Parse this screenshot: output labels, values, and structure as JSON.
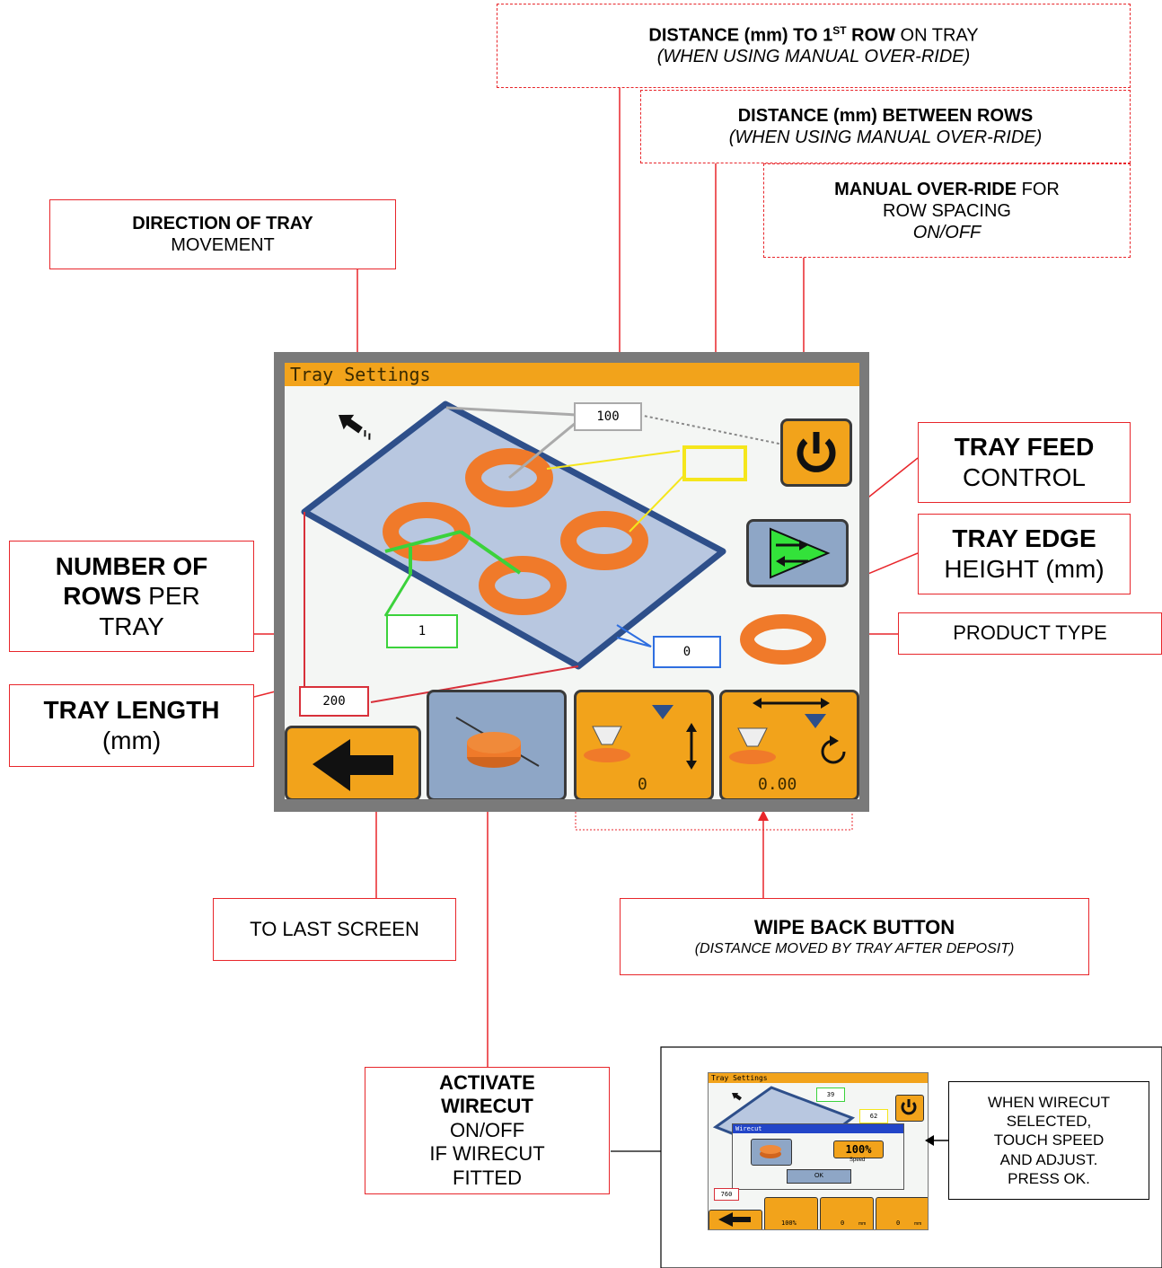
{
  "screen": {
    "title": "Tray Settings",
    "first_row_distance": "100",
    "row_spacing": "",
    "rows_per_tray": "1",
    "tray_edge_height": "0",
    "tray_length": "200",
    "wipe_up_value": "0",
    "wipe_back_value": "0.00"
  },
  "callouts": {
    "first_row": {
      "bold": "DISTANCE (mm) TO 1",
      "sup": "ST",
      "bold2": " ROW",
      "normal": " ON TRAY",
      "italic": "(WHEN USING MANUAL OVER-RIDE)"
    },
    "between_rows": {
      "bold": "DISTANCE (mm) BETWEEN ROWS",
      "italic": "(WHEN USING MANUAL OVER-RIDE)"
    },
    "manual_override": {
      "bold": "MANUAL OVER-RIDE",
      "normal": " FOR",
      "line2": "ROW SPACING",
      "italic": "ON/OFF"
    },
    "direction": {
      "bold": "DIRECTION OF TRAY",
      "normal": "MOVEMENT"
    },
    "tray_feed": {
      "bold": "TRAY FEED",
      "normal": "CONTROL"
    },
    "tray_edge": {
      "bold": "TRAY EDGE",
      "normal": "HEIGHT (mm)"
    },
    "product_type": {
      "normal": "PRODUCT TYPE"
    },
    "rows": {
      "bold1": "NUMBER OF",
      "bold2": "ROWS",
      "normal2": " PER",
      "normal3": "TRAY"
    },
    "tray_length": {
      "bold": "TRAY LENGTH",
      "normal": "(mm)"
    },
    "last_screen": {
      "normal": "TO LAST SCREEN"
    },
    "wipe_back": {
      "bold": "WIPE BACK BUTTON",
      "italic": "(DISTANCE MOVED BY TRAY AFTER DEPOSIT)"
    },
    "wirecut": {
      "bold1": "ACTIVATE",
      "bold2": "WIRECUT",
      "l3": "ON/OFF",
      "l4": "IF WIRECUT",
      "l5": "FITTED"
    }
  },
  "inset": {
    "title": "Tray Settings",
    "dialog_title": "Wirecut",
    "first_row": "39",
    "spacing": "62",
    "length": "760",
    "speed_value": "100%",
    "speed_label": "Speed",
    "ok_label": "OK",
    "bottom_value_1": "100%",
    "bottom_value_2": "0",
    "bottom_value_3": "0",
    "unit": "mm",
    "note_lines": [
      "WHEN WIRECUT",
      "SELECTED,",
      "TOUCH SPEED",
      "AND ADJUST.",
      "PRESS OK."
    ]
  },
  "colors": {
    "callout_border": "#e8262b",
    "screen_orange": "#f2a31b",
    "tray_blue": "#2e4f8a",
    "product_orange": "#f07a2a"
  }
}
